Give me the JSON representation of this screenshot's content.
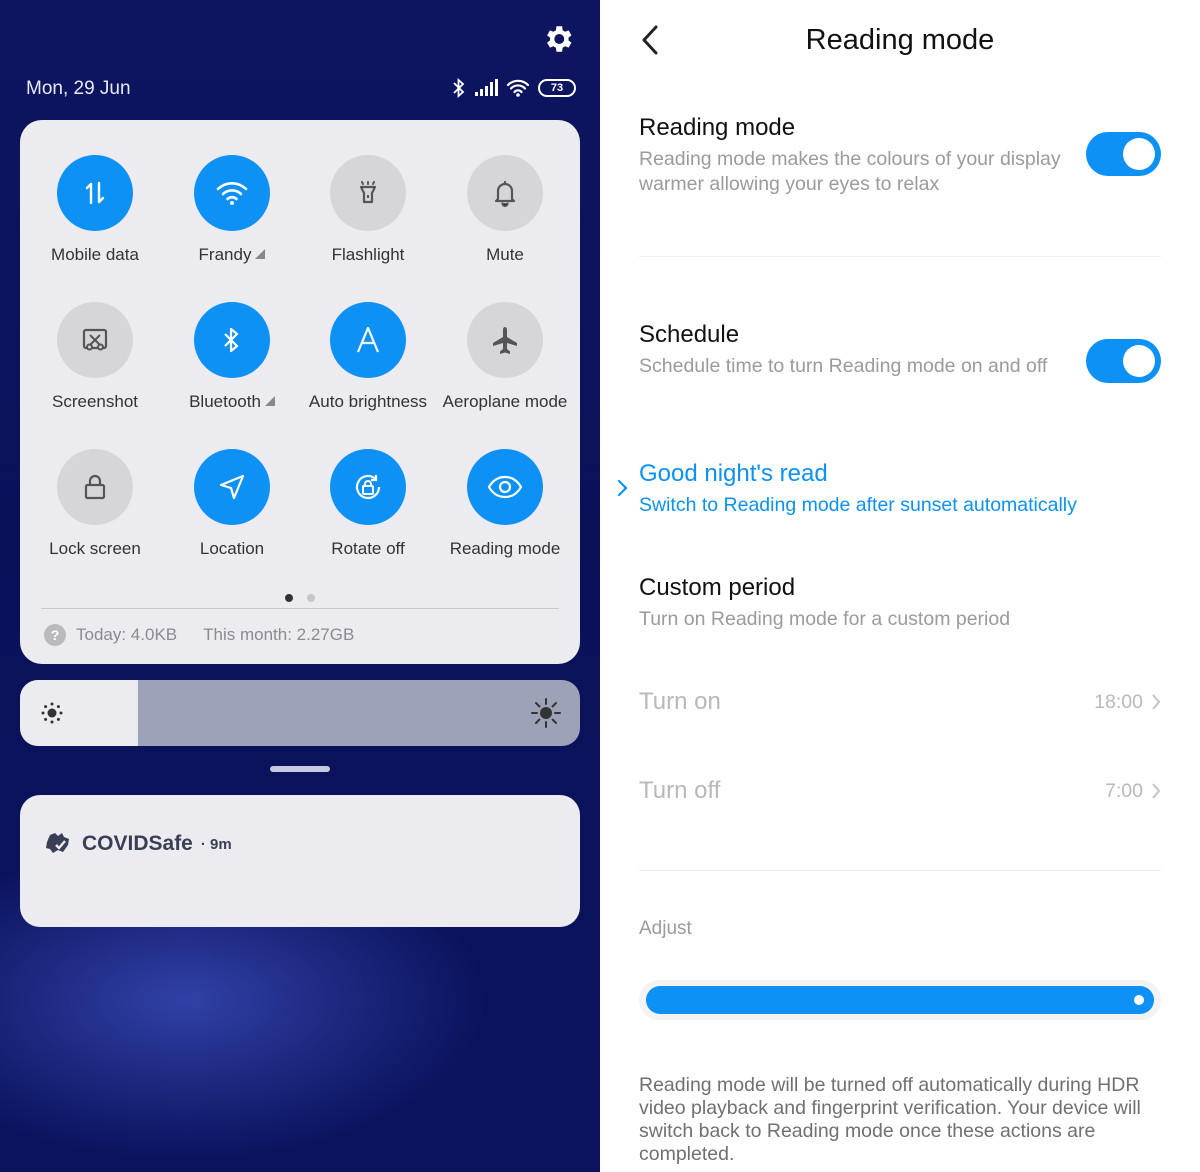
{
  "left": {
    "date": "Mon, 29 Jun",
    "status": {
      "battery": "73",
      "icons": [
        "bluetooth-icon",
        "signal-icon",
        "wifi-icon",
        "battery-icon"
      ]
    },
    "tiles": [
      {
        "label": "Mobile data",
        "on": true,
        "icon": "mobile-data-icon"
      },
      {
        "label": "Frandy",
        "on": true,
        "icon": "wifi-icon",
        "triangle": true
      },
      {
        "label": "Flashlight",
        "on": false,
        "icon": "flashlight-icon"
      },
      {
        "label": "Mute",
        "on": false,
        "icon": "bell-icon"
      },
      {
        "label": "Screenshot",
        "on": false,
        "icon": "screenshot-icon"
      },
      {
        "label": "Bluetooth",
        "on": true,
        "icon": "bluetooth-icon",
        "triangle": true
      },
      {
        "label": "Auto brightness",
        "on": true,
        "icon": "auto-brightness-icon"
      },
      {
        "label": "Aeroplane mode",
        "on": false,
        "icon": "aeroplane-icon"
      },
      {
        "label": "Lock screen",
        "on": false,
        "icon": "lock-icon"
      },
      {
        "label": "Location",
        "on": true,
        "icon": "location-icon"
      },
      {
        "label": "Rotate off",
        "on": true,
        "icon": "rotate-lock-icon"
      },
      {
        "label": "Reading mode",
        "on": true,
        "icon": "eye-icon"
      }
    ],
    "usage": {
      "today": "Today: 4.0KB",
      "month": "This month: 2.27GB"
    },
    "brightness": 0.21,
    "notification": {
      "app": "COVIDSafe",
      "time": "· 9m"
    },
    "colors": {
      "accent": "#0d91f5",
      "background": "#0a1159"
    }
  },
  "right": {
    "title": "Reading mode",
    "reading": {
      "title": "Reading mode",
      "subtitle": "Reading mode makes the colours of your display warmer allowing your eyes to relax",
      "enabled": true
    },
    "schedule": {
      "title": "Schedule",
      "subtitle": "Schedule time to turn Reading mode on and off",
      "enabled": true
    },
    "good_night": {
      "title": "Good night's read",
      "subtitle": "Switch to Reading mode after sunset automatically"
    },
    "custom": {
      "title": "Custom period",
      "subtitle": "Turn on Reading mode for a custom period"
    },
    "turn_on": {
      "label": "Turn on",
      "value": "18:00"
    },
    "turn_off": {
      "label": "Turn off",
      "value": "7:00"
    },
    "adjust": "Adjust",
    "adjust_level": 1.0,
    "note": "Reading mode will be turned off automatically during HDR video playback and fingerprint verification. Your device will switch back to Reading mode once these actions are completed."
  }
}
